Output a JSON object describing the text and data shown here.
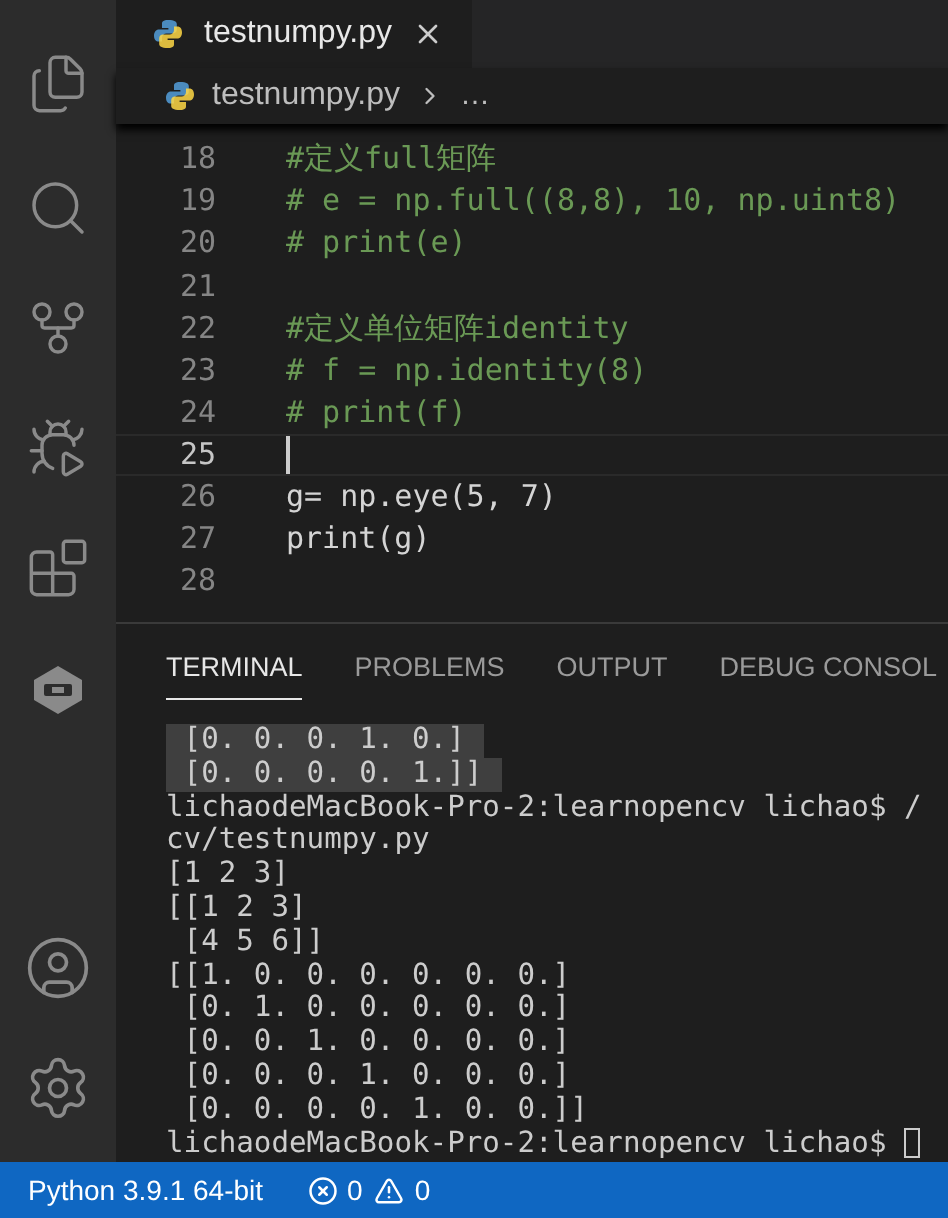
{
  "tabs": [
    {
      "label": "testnumpy.py",
      "selected": true
    }
  ],
  "breadcrumb": {
    "file": "testnumpy.py",
    "more": "…"
  },
  "editor": {
    "lines": [
      {
        "number": "18",
        "text": "#定义full矩阵",
        "kind": "comment",
        "current": false
      },
      {
        "number": "19",
        "text": "# e = np.full((8,8), 10, np.uint8)",
        "kind": "comment",
        "current": false
      },
      {
        "number": "20",
        "text": "# print(e)",
        "kind": "comment",
        "current": false
      },
      {
        "number": "21",
        "current": false
      },
      {
        "number": "22",
        "text": "#定义单位矩阵identity",
        "kind": "comment",
        "current": false
      },
      {
        "number": "23",
        "text": "# f = np.identity(8)",
        "kind": "comment",
        "current": false
      },
      {
        "number": "24",
        "text": "# print(f)",
        "kind": "comment",
        "current": false
      },
      {
        "number": "25",
        "current": true
      },
      {
        "number": "26",
        "text": "g= np.eye(5, 7)",
        "kind": "code",
        "current": false
      },
      {
        "number": "27",
        "text": "print(g)",
        "kind": "code",
        "current": false
      },
      {
        "number": "28",
        "current": false
      }
    ]
  },
  "panel_tabs": [
    {
      "label": "TERMINAL",
      "selected": true
    },
    {
      "label": "PROBLEMS",
      "selected": false
    },
    {
      "label": "OUTPUT",
      "selected": false
    },
    {
      "label": "DEBUG CONSOL",
      "selected": false
    }
  ],
  "terminal": {
    "cursor": true,
    "lines": [
      {
        "text": " [0. 0. 0. 1. 0.]",
        "selected": true
      },
      {
        "text": " [0. 0. 0. 0. 1.]]",
        "selected": true
      },
      {
        "text": "lichaodeMacBook-Pro-2:learnopencv lichao$ /",
        "selected": false
      },
      {
        "text": "cv/testnumpy.py",
        "selected": false
      },
      {
        "text": "[1 2 3]",
        "selected": false
      },
      {
        "text": "[[1 2 3]",
        "selected": false
      },
      {
        "text": " [4 5 6]]",
        "selected": false
      },
      {
        "text": "[[1. 0. 0. 0. 0. 0. 0.]",
        "selected": false
      },
      {
        "text": " [0. 1. 0. 0. 0. 0. 0.]",
        "selected": false
      },
      {
        "text": " [0. 0. 1. 0. 0. 0. 0.]",
        "selected": false
      },
      {
        "text": " [0. 0. 0. 1. 0. 0. 0.]",
        "selected": false
      },
      {
        "text": " [0. 0. 0. 0. 1. 0. 0.]]",
        "selected": false
      },
      {
        "text": "lichaodeMacBook-Pro-2:learnopencv lichao$",
        "selected": false
      }
    ]
  },
  "status_bar": {
    "interpreter": "Python 3.9.1 64-bit",
    "errors": "0",
    "warnings": "0"
  }
}
